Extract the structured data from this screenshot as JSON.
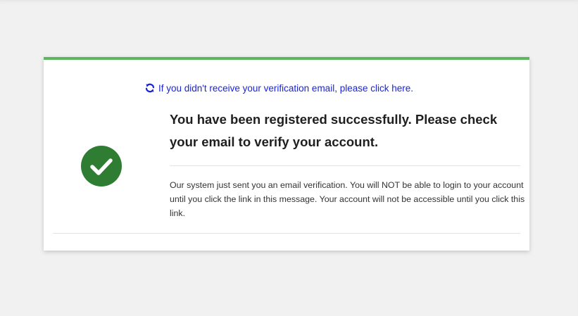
{
  "verification": {
    "resend_link": "If you didn't receive your verification email, please click here.",
    "resend_icon": "refresh-icon",
    "status_icon": "check-circle-icon",
    "headline": "You have been registered successfully. Please check your email to verify your account.",
    "message": "Our system just sent you an email verification. You will NOT be able to login to your account until you click the link in this message. Your account will not be accessible until you click this link."
  },
  "colors": {
    "accent_top_border": "#5cb85c",
    "success_badge": "#2e7d32",
    "link": "#1a24d8",
    "page_background": "#f1f1f1"
  }
}
